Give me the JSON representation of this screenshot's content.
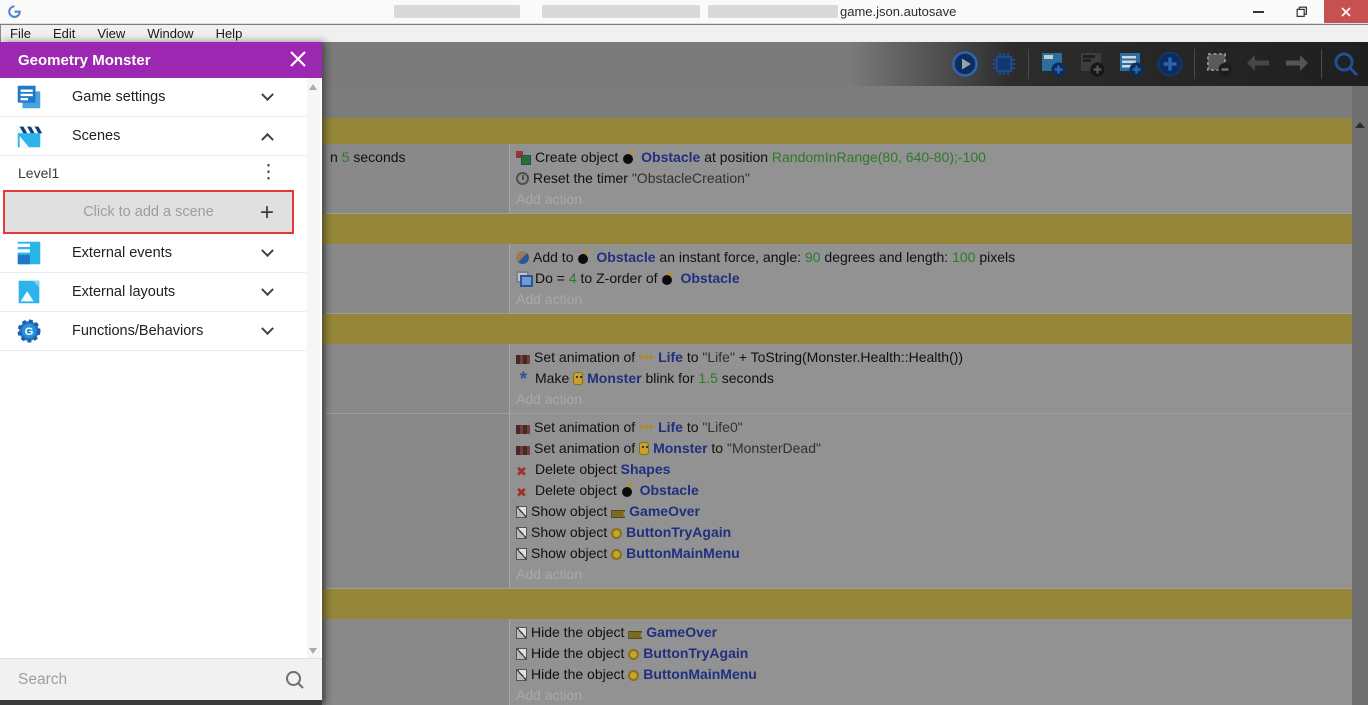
{
  "titlebar": {
    "title": "game.json.autosave"
  },
  "menubar": {
    "file": "File",
    "edit": "Edit",
    "view": "View",
    "window": "Window",
    "help": "Help"
  },
  "toolbar": {
    "icons": [
      "play",
      "debug",
      "add-event",
      "add-sub-event",
      "add-comment",
      "add-new",
      "delete-event",
      "undo",
      "redo",
      "search"
    ]
  },
  "drawer": {
    "title": "Geometry Monster",
    "game_settings_label": "Game settings",
    "scenes_label": "Scenes",
    "scene1_label": "Level1",
    "add_scene_label": "Click to add a scene",
    "external_events_label": "External events",
    "external_layouts_label": "External layouts",
    "functions_label": "Functions/Behaviors",
    "search_placeholder": "Search"
  },
  "colors": {
    "accent_purple": "#9c27b0",
    "group_header_gold": "#95863a",
    "highlight_red": "#e33939",
    "object_name_blue": "#20307f",
    "value_green": "#2d7a27",
    "close_button_red": "#c75050"
  },
  "events": {
    "add_action_label": "Add action",
    "blocks": [
      {
        "type": "group"
      },
      {
        "type": "event",
        "conditions": [
          [
            {
              "t": "n "
            },
            {
              "g": "5"
            },
            {
              "t": " seconds"
            }
          ]
        ],
        "actions": [
          [
            {
              "i": "create-object"
            },
            {
              "t": "Create object "
            },
            {
              "i": "obstacle"
            },
            {
              "o": "Obstacle"
            },
            {
              "t": " at position "
            },
            {
              "g": "RandomInRange(80, 640-80);-100"
            }
          ],
          [
            {
              "i": "reset-timer"
            },
            {
              "t": "Reset the timer "
            },
            {
              "s": "\"ObstacleCreation\""
            }
          ]
        ]
      },
      {
        "type": "group"
      },
      {
        "type": "event",
        "conditions": [],
        "actions": [
          [
            {
              "i": "add-force"
            },
            {
              "t": "Add to "
            },
            {
              "i": "obstacle"
            },
            {
              "o": "Obstacle"
            },
            {
              "t": " an instant force, angle: "
            },
            {
              "g": "90"
            },
            {
              "t": " degrees and length: "
            },
            {
              "g": "100"
            },
            {
              "t": " pixels"
            }
          ],
          [
            {
              "i": "z-order"
            },
            {
              "t": "Do = "
            },
            {
              "g": "4"
            },
            {
              "t": " to Z-order of "
            },
            {
              "i": "obstacle"
            },
            {
              "o": "Obstacle"
            }
          ]
        ]
      },
      {
        "type": "group"
      },
      {
        "type": "event",
        "conditions": [],
        "actions": [
          [
            {
              "i": "set-animation"
            },
            {
              "t": "Set animation of "
            },
            {
              "i": "life"
            },
            {
              "o": "Life"
            },
            {
              "t": " to "
            },
            {
              "s": "\"Life\""
            },
            {
              "t": " + ToString(Monster.Health::Health())"
            }
          ],
          [
            {
              "i": "blink"
            },
            {
              "t": "Make "
            },
            {
              "i": "monster"
            },
            {
              "o": "Monster"
            },
            {
              "t": " blink for "
            },
            {
              "g": "1.5"
            },
            {
              "t": " seconds"
            }
          ]
        ]
      },
      {
        "type": "event",
        "conditions": [],
        "actions": [
          [
            {
              "i": "set-animation"
            },
            {
              "t": "Set animation of "
            },
            {
              "i": "life"
            },
            {
              "o": "Life"
            },
            {
              "t": " to "
            },
            {
              "s": "\"Life0\""
            }
          ],
          [
            {
              "i": "set-animation"
            },
            {
              "t": "Set animation of "
            },
            {
              "i": "monster"
            },
            {
              "o": "Monster"
            },
            {
              "t": " to "
            },
            {
              "s": "\"MonsterDead\""
            }
          ],
          [
            {
              "i": "delete"
            },
            {
              "t": "Delete object "
            },
            {
              "o": "Shapes"
            }
          ],
          [
            {
              "i": "delete"
            },
            {
              "t": "Delete object "
            },
            {
              "i": "obstacle"
            },
            {
              "o": "Obstacle"
            }
          ],
          [
            {
              "i": "visibility"
            },
            {
              "t": "Show object "
            },
            {
              "i": "gameover"
            },
            {
              "o": "GameOver"
            }
          ],
          [
            {
              "i": "visibility"
            },
            {
              "t": "Show object "
            },
            {
              "i": "button-gold"
            },
            {
              "o": "ButtonTryAgain"
            }
          ],
          [
            {
              "i": "visibility"
            },
            {
              "t": "Show object "
            },
            {
              "i": "button-gold"
            },
            {
              "o": "ButtonMainMenu"
            }
          ]
        ]
      },
      {
        "type": "group"
      },
      {
        "type": "event",
        "conditions": [],
        "actions": [
          [
            {
              "i": "visibility"
            },
            {
              "t": "Hide the object "
            },
            {
              "i": "gameover"
            },
            {
              "o": "GameOver"
            }
          ],
          [
            {
              "i": "visibility"
            },
            {
              "t": "Hide the object "
            },
            {
              "i": "button-gold"
            },
            {
              "o": "ButtonTryAgain"
            }
          ],
          [
            {
              "i": "visibility"
            },
            {
              "t": "Hide the object "
            },
            {
              "i": "button-gold"
            },
            {
              "o": "ButtonMainMenu"
            }
          ]
        ]
      }
    ]
  }
}
